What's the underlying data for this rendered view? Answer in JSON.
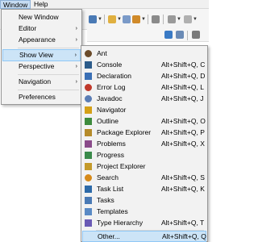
{
  "menubar": {
    "window": "Window",
    "help": "Help"
  },
  "window_menu": {
    "items": [
      {
        "label": "New Window",
        "has_submenu": false
      },
      {
        "label": "Editor",
        "has_submenu": true
      },
      {
        "label": "Appearance",
        "has_submenu": true
      },
      {
        "label": "Show View",
        "has_submenu": true,
        "active": true
      },
      {
        "label": "Perspective",
        "has_submenu": true
      },
      {
        "label": "Navigation",
        "has_submenu": true
      },
      {
        "label": "Preferences",
        "has_submenu": false
      }
    ],
    "arrow": "›"
  },
  "show_view_menu": {
    "items": [
      {
        "label": "Ant",
        "shortcut": "",
        "icon": "ant-icon",
        "color": "#6b4b2a"
      },
      {
        "label": "Console",
        "shortcut": "Alt+Shift+Q, C",
        "icon": "console-icon",
        "color": "#2d5c8a"
      },
      {
        "label": "Declaration",
        "shortcut": "Alt+Shift+Q, D",
        "icon": "declaration-icon",
        "color": "#3a6fb5"
      },
      {
        "label": "Error Log",
        "shortcut": "Alt+Shift+Q, L",
        "icon": "error-log-icon",
        "color": "#c0392b"
      },
      {
        "label": "Javadoc",
        "shortcut": "Alt+Shift+Q, J",
        "icon": "javadoc-icon",
        "color": "#5a7db5"
      },
      {
        "label": "Navigator",
        "shortcut": "",
        "icon": "navigator-icon",
        "color": "#d4a017"
      },
      {
        "label": "Outline",
        "shortcut": "Alt+Shift+Q, O",
        "icon": "outline-icon",
        "color": "#3d8b3d"
      },
      {
        "label": "Package Explorer",
        "shortcut": "Alt+Shift+Q, P",
        "icon": "package-explorer-icon",
        "color": "#b58b2a"
      },
      {
        "label": "Problems",
        "shortcut": "Alt+Shift+Q, X",
        "icon": "problems-icon",
        "color": "#8a4b8a"
      },
      {
        "label": "Progress",
        "shortcut": "",
        "icon": "progress-icon",
        "color": "#3a8a4a"
      },
      {
        "label": "Project Explorer",
        "shortcut": "",
        "icon": "project-explorer-icon",
        "color": "#c49a2a"
      },
      {
        "label": "Search",
        "shortcut": "Alt+Shift+Q, S",
        "icon": "search-icon",
        "color": "#d68a1a"
      },
      {
        "label": "Task List",
        "shortcut": "Alt+Shift+Q, K",
        "icon": "task-list-icon",
        "color": "#2d6aa8"
      },
      {
        "label": "Tasks",
        "shortcut": "",
        "icon": "tasks-icon",
        "color": "#4a7ab5"
      },
      {
        "label": "Templates",
        "shortcut": "",
        "icon": "templates-icon",
        "color": "#5a8ac5"
      },
      {
        "label": "Type Hierarchy",
        "shortcut": "Alt+Shift+Q, T",
        "icon": "type-hierarchy-icon",
        "color": "#6a5ab5"
      },
      {
        "label": "Other...",
        "shortcut": "Alt+Shift+Q, Q",
        "icon": "other-icon",
        "color": "#555555",
        "hover": true
      }
    ]
  },
  "colors": {
    "menu_highlight": "#cce4f7",
    "menu_highlight_border": "#90c8f6",
    "menu_background": "#f2f2f2"
  }
}
